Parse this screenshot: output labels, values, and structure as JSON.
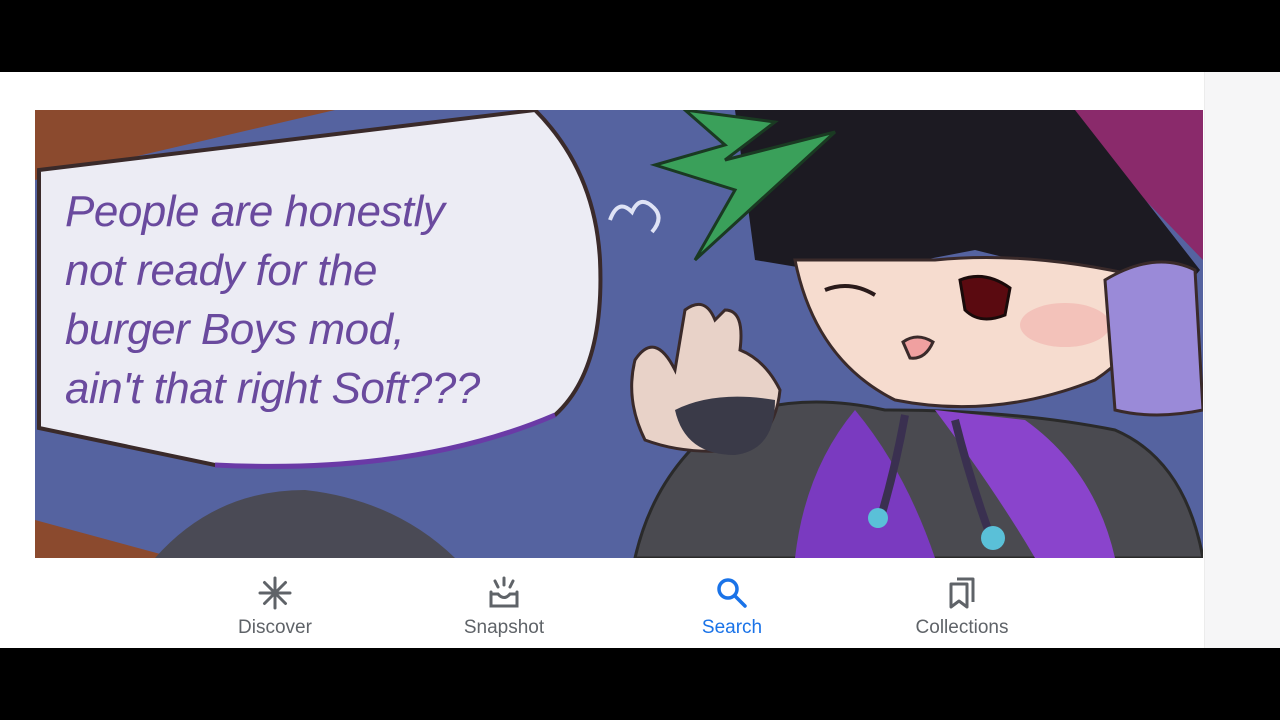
{
  "comic": {
    "speech_text": "People are honestly\nnot ready for the\nburger Boys mod,\nain't that right Soft???"
  },
  "bottom_nav": {
    "items": [
      {
        "label": "Discover",
        "icon": "asterisk-icon",
        "active": false
      },
      {
        "label": "Snapshot",
        "icon": "snapshot-tray-icon",
        "active": false
      },
      {
        "label": "Search",
        "icon": "search-icon",
        "active": true
      },
      {
        "label": "Collections",
        "icon": "bookmarks-icon",
        "active": false
      }
    ]
  },
  "colors": {
    "active": "#1a73e8",
    "inactive": "#5f6368",
    "speech_text": "#6a4a9e"
  }
}
